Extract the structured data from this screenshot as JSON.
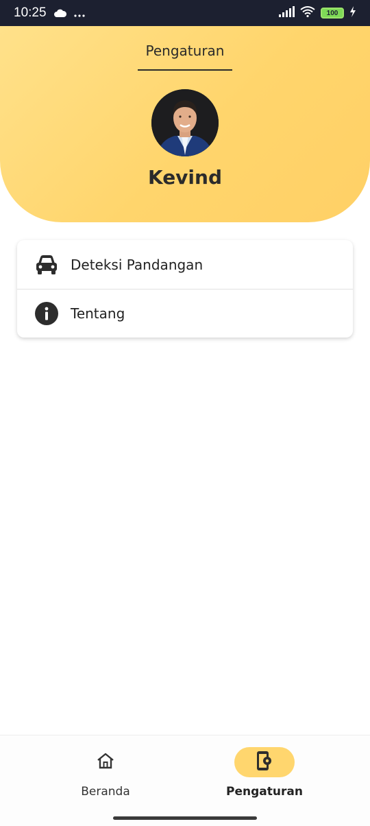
{
  "status_bar": {
    "time": "10:25",
    "battery": "100"
  },
  "header": {
    "title": "Pengaturan",
    "user_name": "Kevind"
  },
  "menu": [
    {
      "label": "Deteksi Pandangan",
      "icon": "car-icon"
    },
    {
      "label": "Tentang",
      "icon": "info-icon"
    }
  ],
  "bottom_nav": {
    "items": [
      {
        "label": "Beranda",
        "icon": "home-icon",
        "active": false
      },
      {
        "label": "Pengaturan",
        "icon": "phone-settings-icon",
        "active": true
      }
    ]
  },
  "colors": {
    "header_gradient_start": "#ffe18a",
    "header_gradient_end": "#ffd066",
    "active_pill": "#ffd66e",
    "status_bar": "#1c2030"
  }
}
